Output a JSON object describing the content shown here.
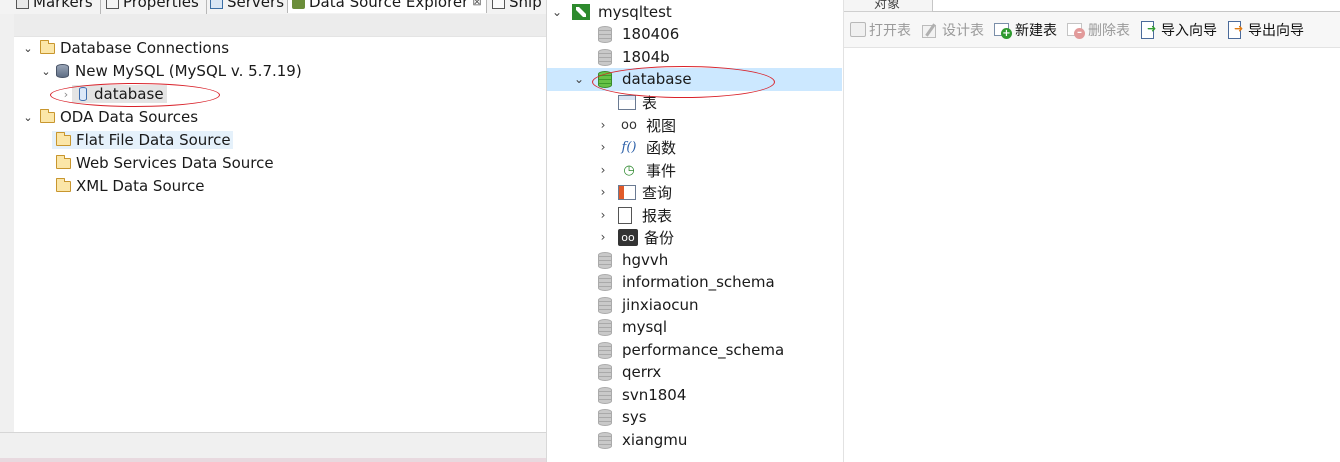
{
  "eclipse": {
    "tabs": [
      {
        "label": "Markers"
      },
      {
        "label": "Properties"
      },
      {
        "label": "Servers"
      },
      {
        "label": "Data Source Explorer",
        "close": "⊠"
      },
      {
        "label": "Snip"
      }
    ],
    "tree": {
      "database_connections": "Database Connections",
      "new_mysql": "New MySQL (MySQL v. 5.7.19)",
      "database": "database",
      "oda_data_sources": "ODA Data Sources",
      "flat_file": "Flat File Data Source",
      "web_services": "Web Services Data Source",
      "xml": "XML Data Source"
    }
  },
  "navicat": {
    "connection": "mysqltest",
    "databases_before": [
      "180406",
      "1804b"
    ],
    "selected_db": "database",
    "db_children": [
      {
        "label": "表",
        "icon": "table-icon",
        "expandable": false
      },
      {
        "label": "视图",
        "icon": "view-icon",
        "expandable": true
      },
      {
        "label": "函数",
        "icon": "function-icon",
        "expandable": true
      },
      {
        "label": "事件",
        "icon": "event-icon",
        "expandable": true
      },
      {
        "label": "查询",
        "icon": "query-icon",
        "expandable": true
      },
      {
        "label": "报表",
        "icon": "report-icon",
        "expandable": true
      },
      {
        "label": "备份",
        "icon": "backup-icon",
        "expandable": true
      }
    ],
    "databases_after": [
      "hgvvh",
      "information_schema",
      "jinxiaocun",
      "mysql",
      "performance_schema",
      "qerrx",
      "svn1804",
      "sys",
      "xiangmu"
    ],
    "object_bar_label": "对象",
    "toolbar": {
      "open_table": "打开表",
      "design_table": "设计表",
      "new_table": "新建表",
      "delete_table": "删除表",
      "import_wizard": "导入向导",
      "export_wizard": "导出向导"
    }
  },
  "colors": {
    "annotation_red": "#d9222a",
    "selection_blue": "#cce8ff",
    "db_green": "#3e9b2c"
  }
}
